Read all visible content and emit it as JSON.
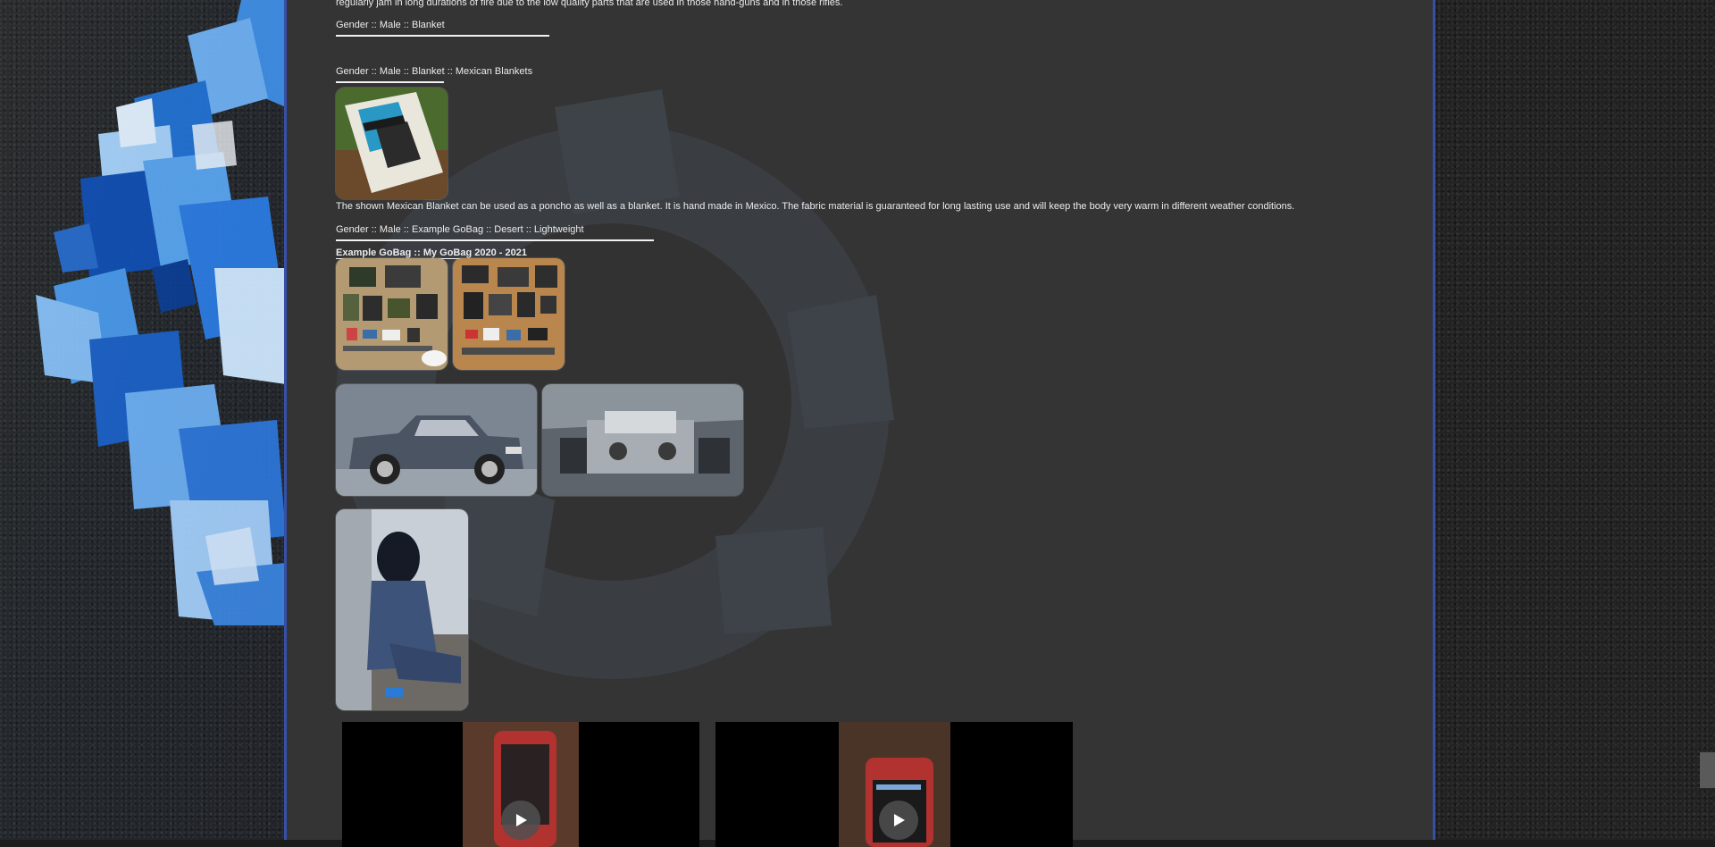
{
  "body_text_top": "regularly jam in long durations of fire due to the low quality parts that are used in those hand-guns and in those rifles.",
  "categories": {
    "blanket": "Gender :: Male :: Blanket",
    "mexican_blankets": "Gender :: Male :: Blanket :: Mexican Blankets",
    "gobag": "Gender :: Male :: Example GoBag :: Desert :: Lightweight"
  },
  "blanket_description": "The shown Mexican Blanket can be used as a poncho as well as a blanket. It is hand made in Mexico. The fabric material is guaranteed for long lasting use and will keep the body very warm in different weather conditions.",
  "gobag_title_link": "Example GoBag",
  "gobag_title_sep": " :: ",
  "gobag_title_rest": "My GoBag 2020 - 2021",
  "images": {
    "blanket": "mexican-blanket-photo",
    "gobag1": "gobag-layout-photo-1",
    "gobag2": "gobag-layout-photo-2",
    "truck": "pickup-truck-photo",
    "engine": "engine-bay-photo",
    "person": "person-sitting-photo"
  },
  "videos": [
    {
      "name": "video-1",
      "icon": "play-icon"
    },
    {
      "name": "video-2",
      "icon": "play-icon"
    }
  ],
  "colors": {
    "panel": "#343434",
    "panel_border": "#3650a8",
    "text": "#ececec",
    "underline": "#f2f2f2"
  }
}
